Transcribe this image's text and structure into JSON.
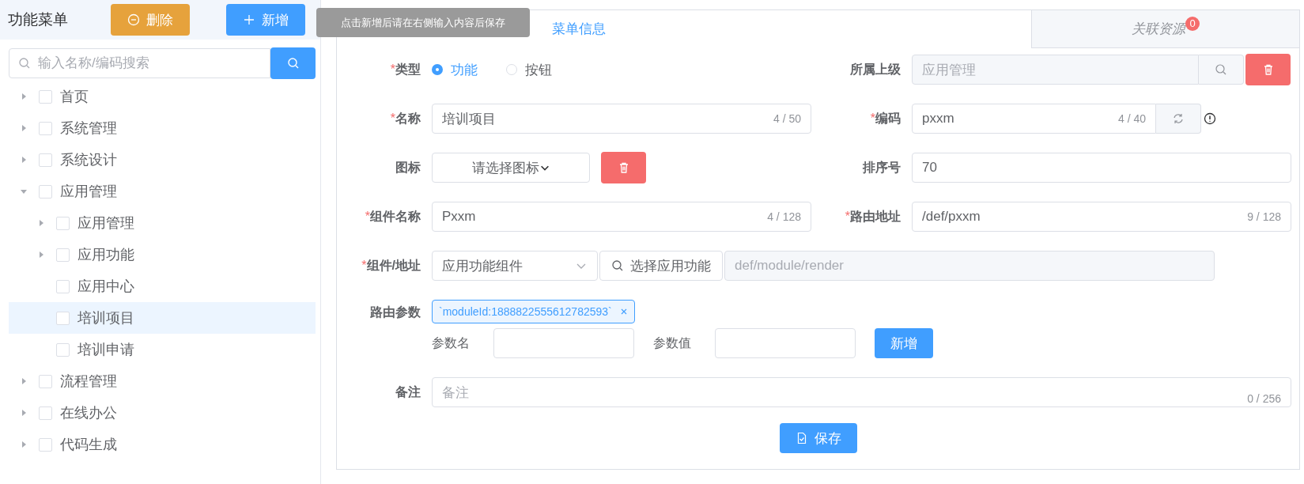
{
  "sidebar": {
    "title": "功能菜单",
    "delete_button": "删除",
    "add_button": "新增",
    "tooltip": "点击新增后请在右侧输入内容后保存",
    "search": {
      "placeholder": "输入名称/编码搜索"
    },
    "tree": [
      {
        "label": "首页",
        "kind": "branch",
        "expanded": false,
        "checked": false,
        "selected": false
      },
      {
        "label": "系统管理",
        "kind": "branch",
        "expanded": false,
        "checked": false,
        "selected": false
      },
      {
        "label": "系统设计",
        "kind": "branch",
        "expanded": false,
        "checked": false,
        "selected": false
      },
      {
        "label": "应用管理",
        "kind": "branch",
        "expanded": true,
        "checked": false,
        "selected": false,
        "children": [
          {
            "label": "应用管理",
            "kind": "branch",
            "expanded": false,
            "checked": false,
            "selected": false
          },
          {
            "label": "应用功能",
            "kind": "branch",
            "expanded": false,
            "checked": false,
            "selected": false
          },
          {
            "label": "应用中心",
            "kind": "leaf",
            "checked": false,
            "selected": false
          },
          {
            "label": "培训项目",
            "kind": "leaf",
            "checked": false,
            "selected": true
          },
          {
            "label": "培训申请",
            "kind": "leaf",
            "checked": false,
            "selected": false
          }
        ]
      },
      {
        "label": "流程管理",
        "kind": "branch",
        "expanded": false,
        "checked": false,
        "selected": false
      },
      {
        "label": "在线办公",
        "kind": "branch",
        "expanded": false,
        "checked": false,
        "selected": false
      },
      {
        "label": "代码生成",
        "kind": "branch",
        "expanded": false,
        "checked": false,
        "selected": false
      }
    ]
  },
  "tabs": [
    {
      "label": "菜单信息",
      "selected": true
    },
    {
      "label": "关联资源",
      "selected": false,
      "badge": "0"
    }
  ],
  "form": {
    "required_mark": "*",
    "type": {
      "label": "类型",
      "required": true,
      "options": [
        {
          "label": "功能",
          "selected": true
        },
        {
          "label": "按钮",
          "selected": false
        }
      ]
    },
    "parent": {
      "label": "所属上级",
      "required": false,
      "value": "应用管理",
      "disabled": true
    },
    "name": {
      "label": "名称",
      "required": true,
      "value": "培训项目",
      "count": "4 / 50"
    },
    "code": {
      "label": "编码",
      "required": true,
      "value": "pxxm",
      "count": "4 / 40"
    },
    "icon": {
      "label": "图标",
      "required": false,
      "value": "请选择图标"
    },
    "sort": {
      "label": "排序号",
      "required": false,
      "value": "70"
    },
    "component_name": {
      "label": "组件名称",
      "required": true,
      "value": "Pxxm",
      "count": "4 / 128"
    },
    "route": {
      "label": "路由地址",
      "required": true,
      "value": "/def/pxxm",
      "count": "9 / 128"
    },
    "component": {
      "label": "组件/地址",
      "required": true,
      "select": "应用功能组件",
      "button": "选择应用功能",
      "path": "def/module/render"
    },
    "route_params": {
      "label": "路由参数",
      "required": false,
      "tags": [
        "`moduleId:1888822555612782593`"
      ],
      "name_label": "参数名",
      "value_label": "参数值",
      "add_button": "新增"
    },
    "remark": {
      "label": "备注",
      "required": false,
      "placeholder": "备注",
      "count": "0 / 256"
    }
  },
  "save_button": "保存"
}
